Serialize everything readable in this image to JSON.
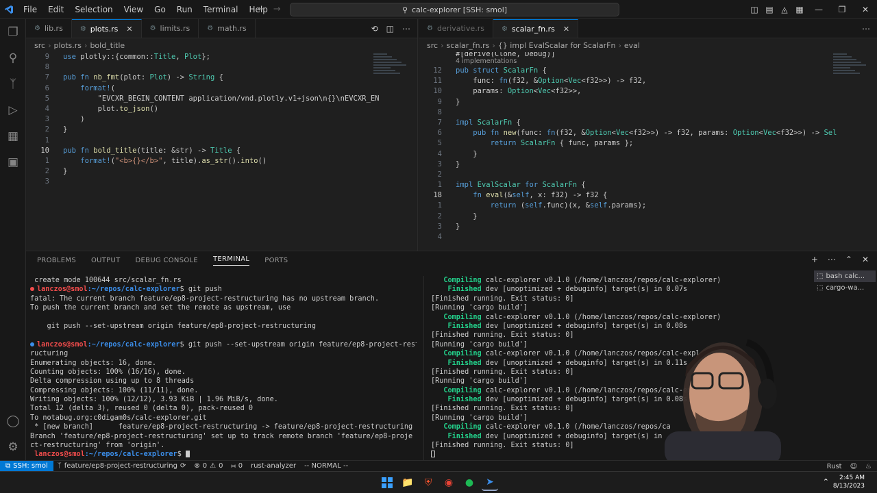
{
  "titlebar": {
    "menus": [
      "File",
      "Edit",
      "Selection",
      "View",
      "Go",
      "Run",
      "Terminal",
      "Help"
    ],
    "search_text": "calc-explorer [SSH: smol]"
  },
  "left_editor": {
    "tabs": [
      {
        "label": "lib.rs",
        "active": false
      },
      {
        "label": "plots.rs",
        "active": true
      },
      {
        "label": "limits.rs",
        "active": false
      },
      {
        "label": "math.rs",
        "active": false
      }
    ],
    "breadcrumbs": [
      "src",
      "plots.rs",
      "bold_title"
    ],
    "lines": [
      {
        "n": "9",
        "text": "use plotly::{common::Title, Plot};"
      },
      {
        "n": "8",
        "text": ""
      },
      {
        "n": "7",
        "text": "pub fn nb_fmt(plot: Plot) -> String {"
      },
      {
        "n": "6",
        "text": "    format!("
      },
      {
        "n": "5",
        "text": "        \"EVCXR_BEGIN_CONTENT application/vnd.plotly.v1+json\\n{}\\nEVCXR_EN"
      },
      {
        "n": "4",
        "text": "        plot.to_json()"
      },
      {
        "n": "3",
        "text": "    )"
      },
      {
        "n": "2",
        "text": "}"
      },
      {
        "n": "1",
        "text": ""
      },
      {
        "n": "10",
        "text": "pub fn bold_title(title: &str) -> Title {"
      },
      {
        "n": "1",
        "text": "    format!(\"<b>{}</b>\", title).as_str().into()"
      },
      {
        "n": "2",
        "text": "}"
      },
      {
        "n": "3",
        "text": ""
      }
    ]
  },
  "right_editor": {
    "tabs": [
      {
        "label": "derivative.rs",
        "active": false
      },
      {
        "label": "scalar_fn.rs",
        "active": true
      }
    ],
    "breadcrumbs": [
      "src",
      "scalar_fn.rs",
      "{} impl EvalScalar for ScalarFn",
      "eval"
    ],
    "top_partial": "#[derive(Clone, Debug)]",
    "codelens": "4 implementations",
    "lines": [
      {
        "n": "12",
        "text": "pub struct ScalarFn {"
      },
      {
        "n": "11",
        "text": "    func: fn(f32, &Option<Vec<f32>>) -> f32,"
      },
      {
        "n": "10",
        "text": "    params: Option<Vec<f32>>,"
      },
      {
        "n": "9",
        "text": "}"
      },
      {
        "n": "8",
        "text": ""
      },
      {
        "n": "7",
        "text": "impl ScalarFn {"
      },
      {
        "n": "6",
        "text": "    pub fn new(func: fn(f32, &Option<Vec<f32>>) -> f32, params: Option<Vec<f32>>) -> Sel"
      },
      {
        "n": "5",
        "text": "        return ScalarFn { func, params };"
      },
      {
        "n": "4",
        "text": "    }"
      },
      {
        "n": "3",
        "text": "}"
      },
      {
        "n": "2",
        "text": ""
      },
      {
        "n": "1",
        "text": "impl EvalScalar for ScalarFn {"
      },
      {
        "n": "18",
        "text": "    fn eval(&self, x: f32) -> f32 {"
      },
      {
        "n": "1",
        "text": "        return (self.func)(x, &self.params);"
      },
      {
        "n": "2",
        "text": "    }"
      },
      {
        "n": "3",
        "text": "}"
      },
      {
        "n": "4",
        "text": ""
      }
    ]
  },
  "panel": {
    "tabs": [
      "PROBLEMS",
      "OUTPUT",
      "DEBUG CONSOLE",
      "TERMINAL",
      "PORTS"
    ],
    "active_tab": "TERMINAL",
    "terminal_left": [
      {
        "kind": "plain",
        "text": " create mode 100644 src/scalar_fn.rs"
      },
      {
        "kind": "prompt",
        "dot": "red",
        "user": "lanczos@smol",
        "path": ":~/repos/calc-explorer",
        "cmd": "$ git push"
      },
      {
        "kind": "plain",
        "text": "fatal: The current branch feature/ep8-project-restructuring has no upstream branch."
      },
      {
        "kind": "plain",
        "text": "To push the current branch and set the remote as upstream, use"
      },
      {
        "kind": "plain",
        "text": ""
      },
      {
        "kind": "plain",
        "text": "    git push --set-upstream origin feature/ep8-project-restructuring"
      },
      {
        "kind": "plain",
        "text": ""
      },
      {
        "kind": "prompt",
        "dot": "blue",
        "user": "lanczos@smol",
        "path": ":~/repos/calc-explorer",
        "cmd": "$ git push --set-upstream origin feature/ep8-project-rest"
      },
      {
        "kind": "plain",
        "text": "ructuring"
      },
      {
        "kind": "plain",
        "text": "Enumerating objects: 16, done."
      },
      {
        "kind": "plain",
        "text": "Counting objects: 100% (16/16), done."
      },
      {
        "kind": "plain",
        "text": "Delta compression using up to 8 threads"
      },
      {
        "kind": "plain",
        "text": "Compressing objects: 100% (11/11), done."
      },
      {
        "kind": "plain",
        "text": "Writing objects: 100% (12/12), 3.93 KiB | 1.96 MiB/s, done."
      },
      {
        "kind": "plain",
        "text": "Total 12 (delta 3), reused 0 (delta 0), pack-reused 0"
      },
      {
        "kind": "plain",
        "text": "To notabug.org:c0digam0s/calc-explorer.git"
      },
      {
        "kind": "plain",
        "text": " * [new branch]      feature/ep8-project-restructuring -> feature/ep8-project-restructuring"
      },
      {
        "kind": "plain",
        "text": "Branch 'feature/ep8-project-restructuring' set up to track remote branch 'feature/ep8-proje"
      },
      {
        "kind": "plain",
        "text": "ct-restructuring' from 'origin'."
      },
      {
        "kind": "prompt_end",
        "user": "lanczos@smol",
        "path": ":~/repos/calc-explorer",
        "cmd": "$ "
      }
    ],
    "terminal_right": [
      {
        "kind": "compile",
        "label": "   Compiling",
        "text": " calc-explorer v0.1.0 (/home/lanczos/repos/calc-explorer)"
      },
      {
        "kind": "compile",
        "label": "    Finished",
        "text": " dev [unoptimized + debuginfo] target(s) in 0.07s"
      },
      {
        "kind": "plain",
        "text": "[Finished running. Exit status: 0]"
      },
      {
        "kind": "plain",
        "text": "[Running 'cargo build']"
      },
      {
        "kind": "compile",
        "label": "   Compiling",
        "text": " calc-explorer v0.1.0 (/home/lanczos/repos/calc-explorer)"
      },
      {
        "kind": "compile",
        "label": "    Finished",
        "text": " dev [unoptimized + debuginfo] target(s) in 0.08s"
      },
      {
        "kind": "plain",
        "text": "[Finished running. Exit status: 0]"
      },
      {
        "kind": "plain",
        "text": "[Running 'cargo build']"
      },
      {
        "kind": "compile",
        "label": "   Compiling",
        "text": " calc-explorer v0.1.0 (/home/lanczos/repos/calc-expl"
      },
      {
        "kind": "compile",
        "label": "    Finished",
        "text": " dev [unoptimized + debuginfo] target(s) in 0.11s"
      },
      {
        "kind": "plain",
        "text": "[Finished running. Exit status: 0]"
      },
      {
        "kind": "plain",
        "text": "[Running 'cargo build']"
      },
      {
        "kind": "compile",
        "label": "   Compiling",
        "text": " calc-explorer v0.1.0 (/home/lanczos/repos/calc-exp"
      },
      {
        "kind": "compile",
        "label": "    Finished",
        "text": " dev [unoptimized + debuginfo] target(s) in 0.08s"
      },
      {
        "kind": "plain",
        "text": "[Finished running. Exit status: 0]"
      },
      {
        "kind": "plain",
        "text": "[Running 'cargo build']"
      },
      {
        "kind": "compile",
        "label": "   Compiling",
        "text": " calc-explorer v0.1.0 (/home/lanczos/repos/ca"
      },
      {
        "kind": "compile",
        "label": "    Finished",
        "text": " dev [unoptimized + debuginfo] target(s) in"
      },
      {
        "kind": "plain",
        "text": "[Finished running. Exit status: 0]"
      },
      {
        "kind": "cursor",
        "text": ""
      }
    ],
    "terminal_list": [
      {
        "label": "bash calc...",
        "active": true
      },
      {
        "label": "cargo-wa...",
        "active": false
      }
    ]
  },
  "statusbar": {
    "remote": "SSH: smol",
    "branch": "feature/ep8-project-restructuring",
    "errors": "0",
    "warnings": "0",
    "ports": "0",
    "analyzer": "rust-analyzer",
    "mode": "-- NORMAL --",
    "language": "Rust"
  },
  "taskbar": {
    "time": "2:45 AM",
    "date": "8/13/2023"
  },
  "colors": {
    "accent": "#0078d4",
    "editor_bg": "#1f1f1f",
    "chrome_bg": "#181818"
  }
}
